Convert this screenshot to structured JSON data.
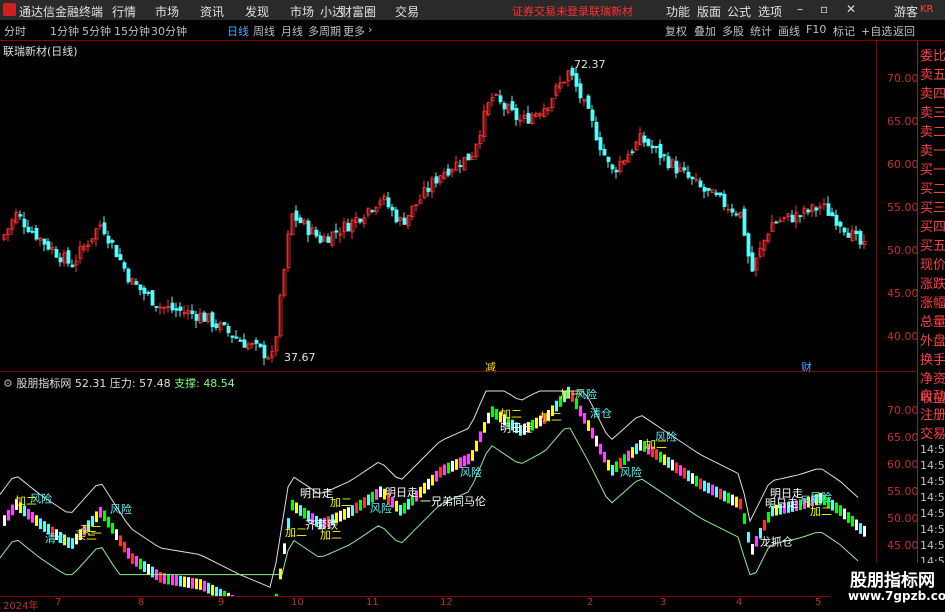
{
  "app": {
    "title": "通达信金融终端",
    "menus": [
      "行情",
      "市场",
      "资讯",
      "发现",
      "市场",
      "小达",
      "财富圈",
      "交易"
    ],
    "notice": "证券交易未登录",
    "stock_link": "联瑞新材",
    "right_menus": [
      "功能",
      "版面",
      "公式",
      "选项"
    ],
    "user": "游客"
  },
  "toolbar": {
    "periods": [
      "分时",
      "1分钟",
      "5分钟",
      "15分钟",
      "30分钟",
      "日线",
      "周线",
      "月线",
      "多周期",
      "更多"
    ],
    "active_period": "日线",
    "tools": [
      "复权",
      "叠加",
      "多股",
      "统计",
      "画线",
      "F10",
      "标记",
      "+自选",
      "返回"
    ]
  },
  "main_chart": {
    "title": "联瑞新材(日线)",
    "high_label": "72.37",
    "low_label": "37.67",
    "markers": [
      "减",
      "财"
    ],
    "ylim": [
      37,
      75
    ],
    "ticks": [
      "70.00",
      "65.00",
      "60.00",
      "55.00",
      "50.00",
      "45.00",
      "40.00"
    ]
  },
  "indicator": {
    "name": "股朋指标网",
    "value": "52.31",
    "pressure_label": "压力:",
    "pressure": "57.48",
    "support_label": "支撑:",
    "support": "48.54",
    "ticks": [
      "70.00",
      "65.00",
      "60.00",
      "55.00",
      "50.00",
      "45.00"
    ],
    "signals": [
      "风险",
      "加二",
      "清仓",
      "风险",
      "买二",
      "风险",
      "加二",
      "买三",
      "风险",
      "明日走",
      "加二",
      "齐套跌",
      "风险",
      "加二",
      "明日走",
      "风险",
      "加二",
      "一兄弟同马伦",
      "明日走",
      "风险",
      "加二",
      "加一",
      "明日走",
      "风险",
      "清仓",
      "风险",
      "加二",
      "明日走",
      "加二",
      "龙抓仓"
    ]
  },
  "side_panel": {
    "items_top": [
      "委比",
      "卖五",
      "卖四",
      "卖三",
      "卖二",
      "卖一",
      "买一",
      "买二",
      "买三",
      "买四",
      "买五",
      "现价",
      "涨跌",
      "涨幅",
      "总量",
      "外盘",
      "换手",
      "净资",
      "收益"
    ],
    "items_bottom": [
      "自动",
      "注册",
      "交易"
    ],
    "times": [
      "14:55",
      "14:55",
      "14:55",
      "14:56",
      "14:56",
      "14:56",
      "14:56",
      "14:56"
    ],
    "badge": "KR"
  },
  "dates": [
    "2024年",
    "7",
    "8",
    "9",
    "10",
    "11",
    "12",
    "2",
    "3",
    "4",
    "5"
  ],
  "watermark": {
    "title": "股朋指标网",
    "url": "www.7gpzb.com"
  },
  "chart_data": {
    "type": "candlestick",
    "title": "联瑞新材(日线)",
    "ylim": [
      37,
      75
    ],
    "annotations": [
      {
        "label": "72.37",
        "type": "high"
      },
      {
        "label": "37.67",
        "type": "low"
      }
    ]
  }
}
